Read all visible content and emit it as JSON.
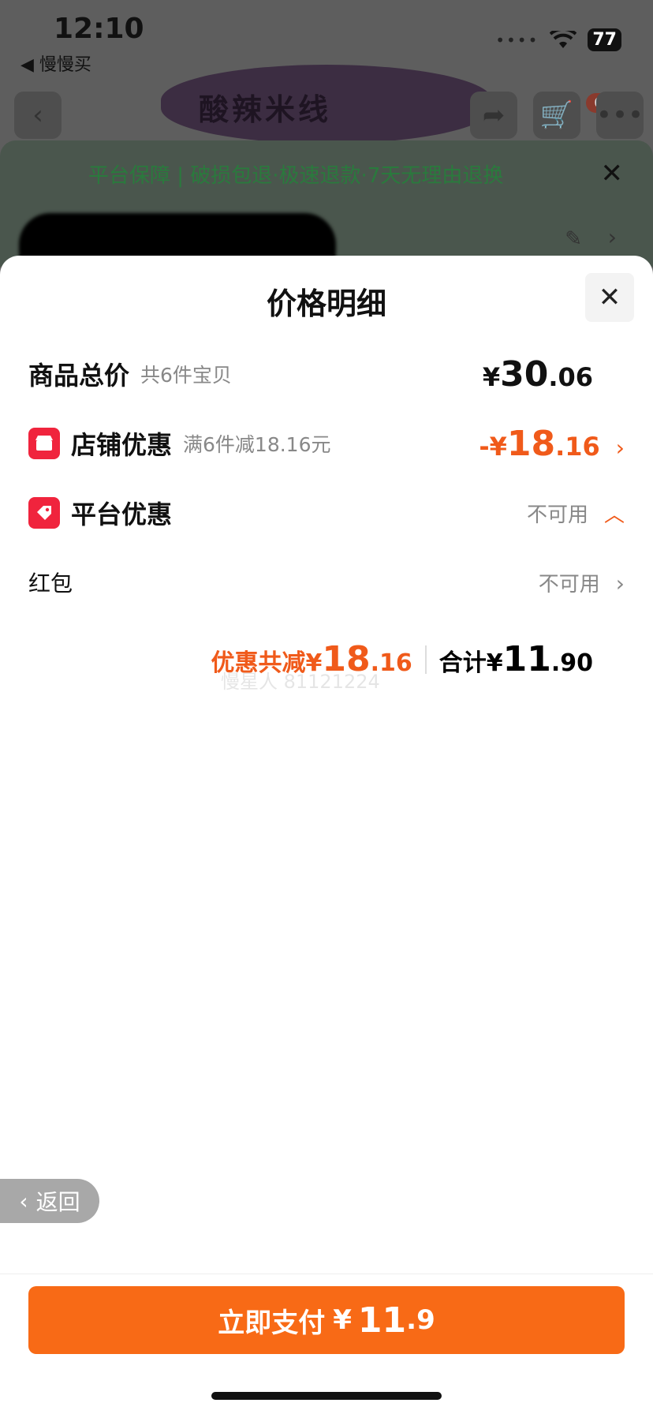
{
  "status_bar": {
    "time": "12:10",
    "battery": "77",
    "back_app": "◀ 慢慢买"
  },
  "background": {
    "product_thumb_text": "酸辣米线",
    "cart_badge": "63",
    "guarantee_text": "平台保障 | 破损包退·极速退款·7天无理由退换"
  },
  "sheet": {
    "title": "价格明细",
    "rows": {
      "total": {
        "label": "商品总价",
        "sub": "共6件宝贝",
        "currency": "¥",
        "int": "30",
        "dec": ".06"
      },
      "shop_discount": {
        "label": "店铺优惠",
        "sub": "满6件减18.16元",
        "prefix": "-¥",
        "int": "18",
        "dec": ".16"
      },
      "platform_discount": {
        "label": "平台优惠",
        "status": "不可用"
      },
      "red_packet": {
        "label": "红包",
        "status": "不可用"
      }
    },
    "summary": {
      "discount_label": "优惠共减¥",
      "discount_int": "18",
      "discount_dec": ".16",
      "total_label": "合计¥",
      "total_int": "11",
      "total_dec": ".90"
    },
    "watermark": "慢星人 81121224",
    "return_label": "返回",
    "pay_button": {
      "label": "立即支付",
      "currency": "¥",
      "int": "11",
      "dec": ".9"
    }
  }
}
